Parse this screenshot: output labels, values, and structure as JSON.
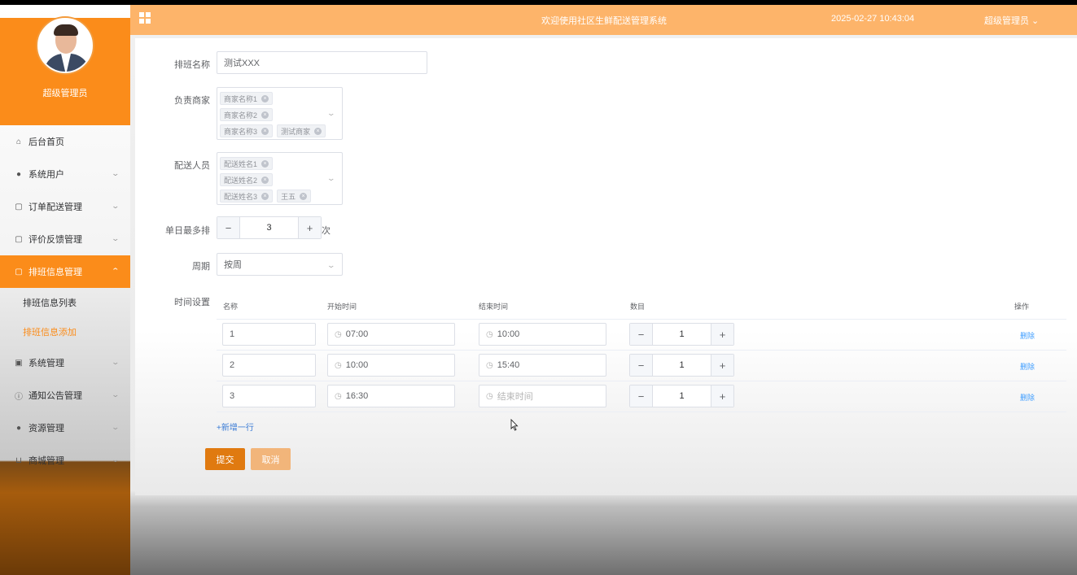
{
  "user": {
    "name": "超级管理员"
  },
  "sidebar": {
    "items": [
      {
        "label": "后台首页",
        "icon": "home-icon",
        "glyph": "⌂"
      },
      {
        "label": "系统用户",
        "icon": "user-icon",
        "glyph": "●"
      },
      {
        "label": "订单配送管理",
        "icon": "document-icon",
        "glyph": "▢"
      },
      {
        "label": "评价反馈管理",
        "icon": "document-icon",
        "glyph": "▢"
      },
      {
        "label": "排班信息管理",
        "icon": "document-icon",
        "glyph": "▢"
      },
      {
        "label": "系统管理",
        "icon": "chart-icon",
        "glyph": "▣"
      },
      {
        "label": "通知公告管理",
        "icon": "info-icon",
        "glyph": "ⓘ"
      },
      {
        "label": "资源管理",
        "icon": "location-icon",
        "glyph": "●"
      },
      {
        "label": "商城管理",
        "icon": "cart-icon",
        "glyph": "⊔"
      }
    ],
    "sub_items": [
      "排班信息列表",
      "排班信息添加"
    ]
  },
  "header": {
    "title": "欢迎使用社区生鲜配送管理系统",
    "datetime": "2025-02-27 10:43:04",
    "user_menu": "超级管理员"
  },
  "form": {
    "name_label": "排班名称",
    "name_value": "测试XXX",
    "merchant_label": "负责商家",
    "merchants": [
      "商家名称1",
      "商家名称2",
      "商家名称3",
      "测试商家"
    ],
    "courier_label": "配送人员",
    "couriers": [
      "配送姓名1",
      "配送姓名2",
      "配送姓名3",
      "王五"
    ],
    "daily_max_label": "单日最多排",
    "daily_max_value": "3",
    "daily_max_unit": "次",
    "period_label": "周期",
    "period_value": "按周",
    "time_label": "时间设置"
  },
  "table": {
    "headers": {
      "name": "名称",
      "start": "开始时间",
      "end": "结束时间",
      "count": "数目",
      "action": "操作"
    },
    "rows": [
      {
        "name": "1",
        "start": "07:00",
        "end": "10:00",
        "count": "1",
        "action": "删除"
      },
      {
        "name": "2",
        "start": "10:00",
        "end": "15:40",
        "count": "1",
        "action": "删除"
      },
      {
        "name": "3",
        "start": "16:30",
        "end": "",
        "end_placeholder": "结束时间",
        "count": "1",
        "action": "删除"
      }
    ],
    "add_row": "+新增一行"
  },
  "buttons": {
    "submit": "提交",
    "cancel": "取消"
  },
  "colors": {
    "primary": "#fb8c1a",
    "topbar": "#fdb46a",
    "link": "#409eff"
  }
}
